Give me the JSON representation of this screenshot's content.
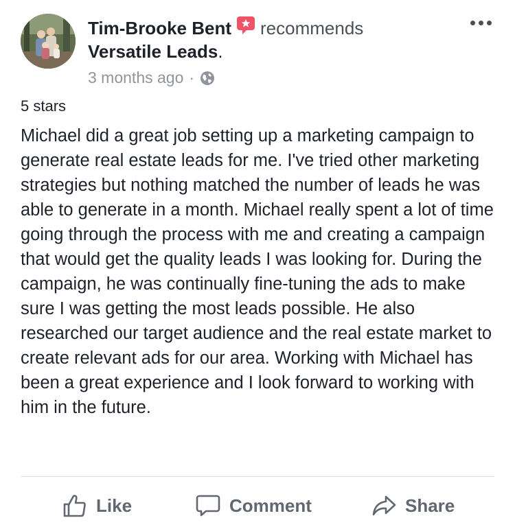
{
  "post": {
    "author": "Tim-Brooke Bent",
    "action": "recommends",
    "page": "Versatile Leads",
    "page_suffix": ".",
    "timestamp": "3 months ago",
    "separator": "·",
    "privacy_icon": "globe-icon",
    "recommend_icon": "recommend-star-icon",
    "rating": "5 stars",
    "review": "Michael did a great job setting up a marketing campaign to generate real estate leads for me. I've tried other marketing strategies but nothing matched the number of leads he was able to generate in a month. Michael really spent a lot of time going through the process with me and creating a campaign that would get the quality leads I was looking for. During the campaign, he was continually fine-tuning the ads to make sure I was getting the most leads possible. He also researched our target audience and the real estate market to create relevant ads for our area. Working with Michael has been a great experience and I look forward to working with him in the future."
  },
  "actions": {
    "like": "Like",
    "comment": "Comment",
    "share": "Share"
  },
  "colors": {
    "recommend_accent": "#f25268",
    "action_text": "#606770",
    "meta_text": "#90949c"
  }
}
